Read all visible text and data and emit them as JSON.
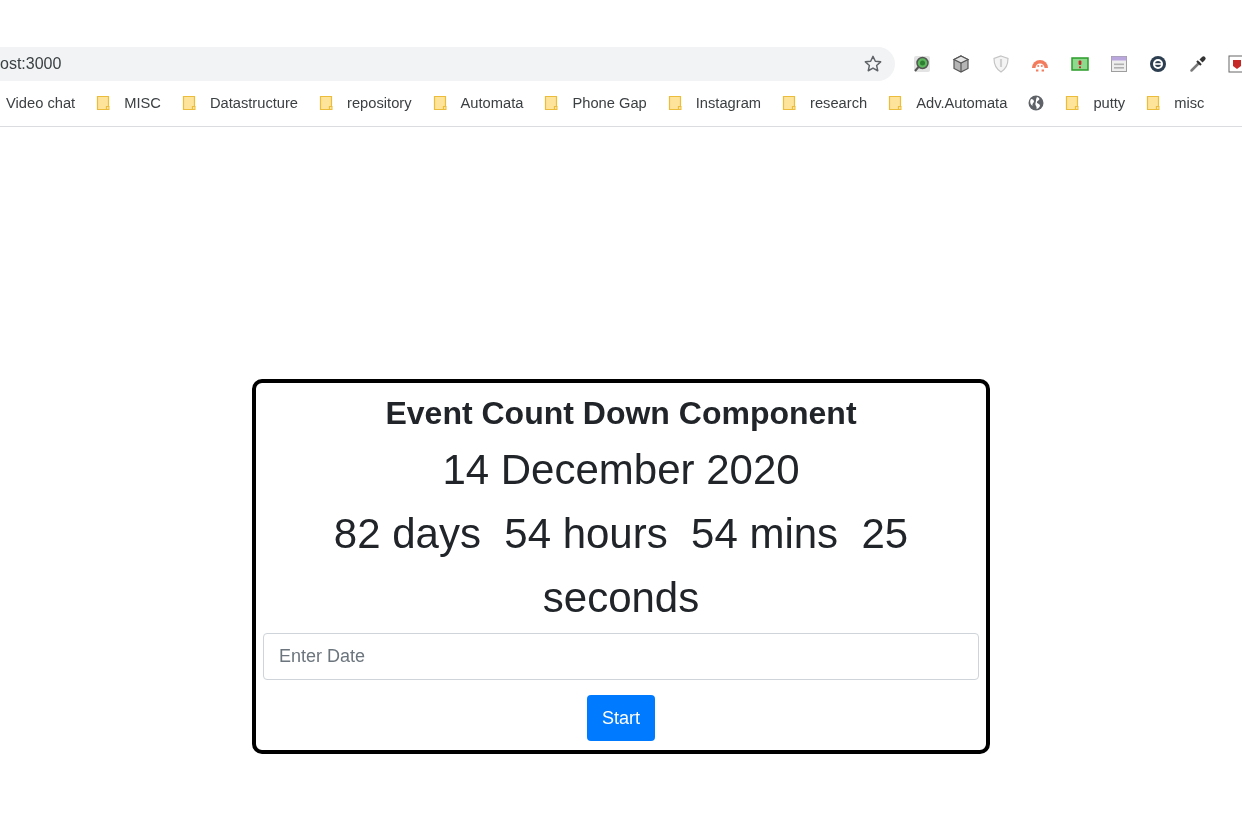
{
  "address_bar": {
    "url": "ost:3000",
    "bookmarked": false
  },
  "bookmarks": [
    {
      "kind": "text",
      "label": "Video chat"
    },
    {
      "kind": "folder",
      "label": "MISC"
    },
    {
      "kind": "folder",
      "label": "Datastructure"
    },
    {
      "kind": "folder",
      "label": "repository"
    },
    {
      "kind": "folder",
      "label": "Automata"
    },
    {
      "kind": "folder",
      "label": "Phone Gap"
    },
    {
      "kind": "folder",
      "label": "Instagram"
    },
    {
      "kind": "folder",
      "label": "research"
    },
    {
      "kind": "folder",
      "label": "Adv.Automata"
    },
    {
      "kind": "site"
    },
    {
      "kind": "folder",
      "label": "putty"
    },
    {
      "kind": "folder",
      "label": "misc"
    }
  ],
  "card": {
    "title": "Event Count Down Component",
    "date": "14 December 2020",
    "countdown": "82 days  54 hours  54 mins  25 seconds",
    "date_input": {
      "placeholder": "Enter Date"
    },
    "button": "Start"
  }
}
